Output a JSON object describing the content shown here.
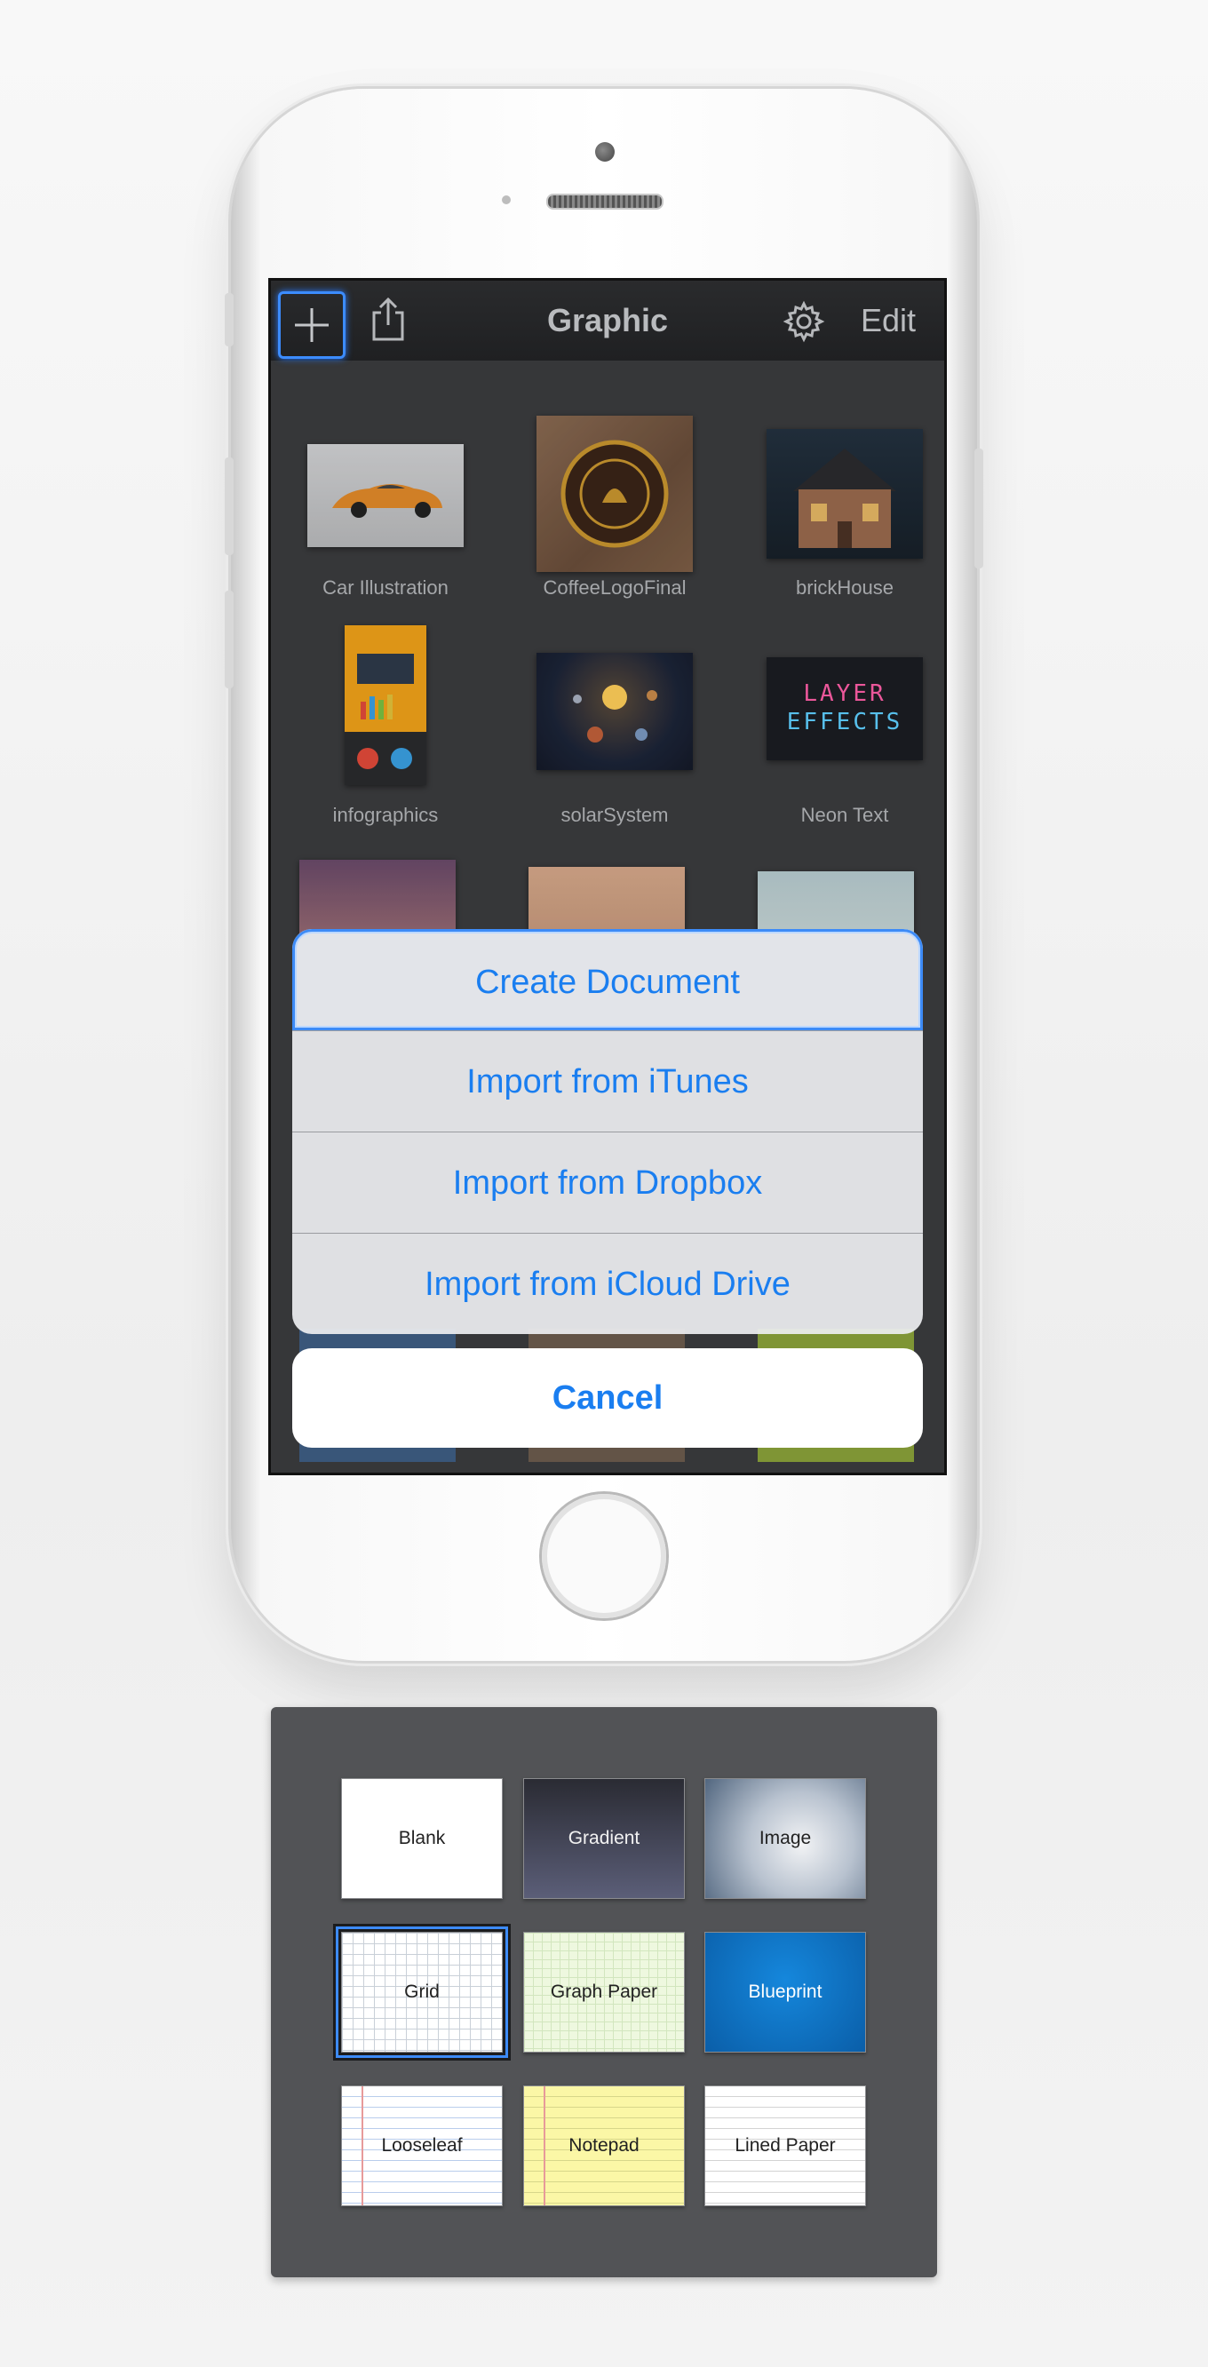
{
  "navbar": {
    "title": "Graphic",
    "edit_label": "Edit",
    "icons": [
      "plus-icon",
      "share-icon",
      "gear-icon"
    ]
  },
  "documents": [
    {
      "label": "Car Illustration"
    },
    {
      "label": "CoffeeLogoFinal"
    },
    {
      "label": "brickHouse"
    },
    {
      "label": "infographics"
    },
    {
      "label": "solarSystem"
    },
    {
      "label": "Neon Text"
    }
  ],
  "neon_text": {
    "line1": "LAYER",
    "line2": "EFFECTS"
  },
  "action_sheet": {
    "items": [
      "Create Document",
      "Import from iTunes",
      "Import from Dropbox",
      "Import from iCloud Drive"
    ],
    "selected_index": 0,
    "cancel_label": "Cancel"
  },
  "templates": [
    {
      "label": "Blank"
    },
    {
      "label": "Gradient"
    },
    {
      "label": "Image"
    },
    {
      "label": "Grid"
    },
    {
      "label": "Graph Paper"
    },
    {
      "label": "Blueprint"
    },
    {
      "label": "Looseleaf"
    },
    {
      "label": "Notepad"
    },
    {
      "label": "Lined Paper"
    }
  ],
  "selected_template": "Grid",
  "colors": {
    "accent": "#1a7ef0",
    "selection": "#3d8bf7",
    "screen_bg": "#3b3c3e",
    "panel_bg": "#525356"
  }
}
